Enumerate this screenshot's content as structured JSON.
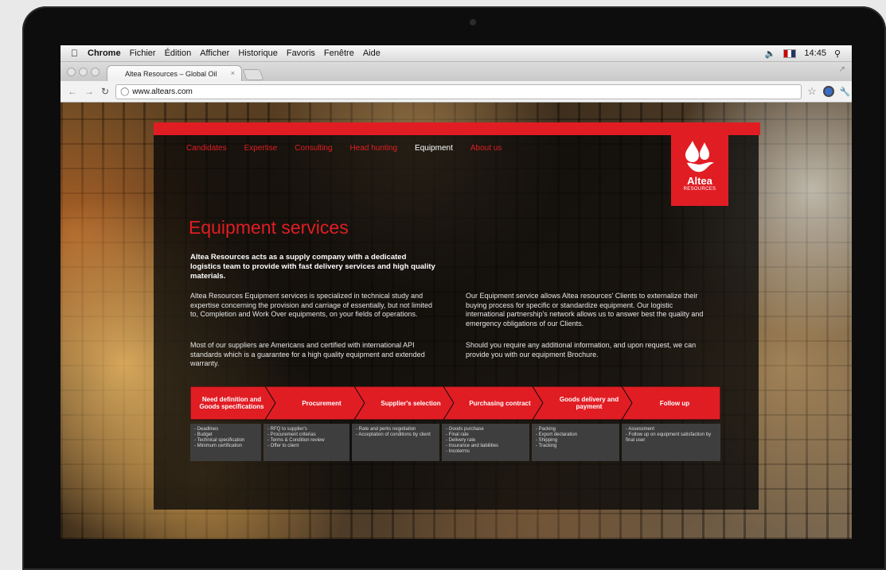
{
  "menubar": {
    "apple": "",
    "app": "Chrome",
    "menus": [
      "Fichier",
      "Édition",
      "Afficher",
      "Historique",
      "Favoris",
      "Fenêtre",
      "Aide"
    ],
    "volume_icon": "speaker-icon",
    "time": "14:45",
    "search_icon": "spotlight-icon"
  },
  "browser": {
    "tab_title": "Altea Resources – Global Oil",
    "tab_close": "×",
    "url": "www.altears.com"
  },
  "site": {
    "nav": [
      "Candidates",
      "Expertise",
      "Consulting",
      "Head hunting",
      "Equipment",
      "About us"
    ],
    "active_nav": "Equipment",
    "logo_text": "Altea",
    "logo_sub": "RESOURCES",
    "heading": "Equipment services",
    "lead": "Altea Resources acts as a supply company with a dedicated logistics team to provide with fast delivery services and high quality materials.",
    "para1": "Altea Resources Equipment services is specialized in technical study and expertise concerning the provision and carriage of essentially, but not limited to, Completion and Work Over equipments, on your fields of operations.",
    "para2": "Most of our suppliers are Americans and certified with international API standards which is a guarantee for a high quality equipment and extended warranty.",
    "para3": "Our Equipment service allows Altea resources' Clients to externalize their buying process for specific or standardize equipment. Our logistic international partnership's network allows us to answer best the quality and emergency obligations of our Clients.",
    "para4": "Should you require any additional information, and upon request, we can provide you with our equipment Brochure."
  },
  "process": [
    {
      "title": "Need definition and Goods specifications",
      "items": [
        "Deadlines",
        "Budget",
        "Technical specification",
        "Minimum certification"
      ]
    },
    {
      "title": "Procurement",
      "items": [
        "RFQ to supplier's",
        "Procurement criterias",
        "Terms & Condition review",
        "Offer to client"
      ]
    },
    {
      "title": "Supplier's selection",
      "items": [
        "Rate and perks negotiation",
        "Acceptation of conditions by client"
      ]
    },
    {
      "title": "Purchasing contract",
      "items": [
        "Goods purchase",
        "Final rate",
        "Delivery rate",
        "Insurance and liabilities",
        "Incoterms"
      ]
    },
    {
      "title": "Goods delivery and payment",
      "items": [
        "Packing",
        "Export declaration",
        "Shipping",
        "Tracking"
      ]
    },
    {
      "title": "Follow up",
      "items": [
        "Assessment",
        "Follow up on equipment satisfaction by final user"
      ]
    }
  ],
  "colors": {
    "brand_red": "#e11d24",
    "panel": "#080808",
    "step_body": "#3e3e3e"
  }
}
